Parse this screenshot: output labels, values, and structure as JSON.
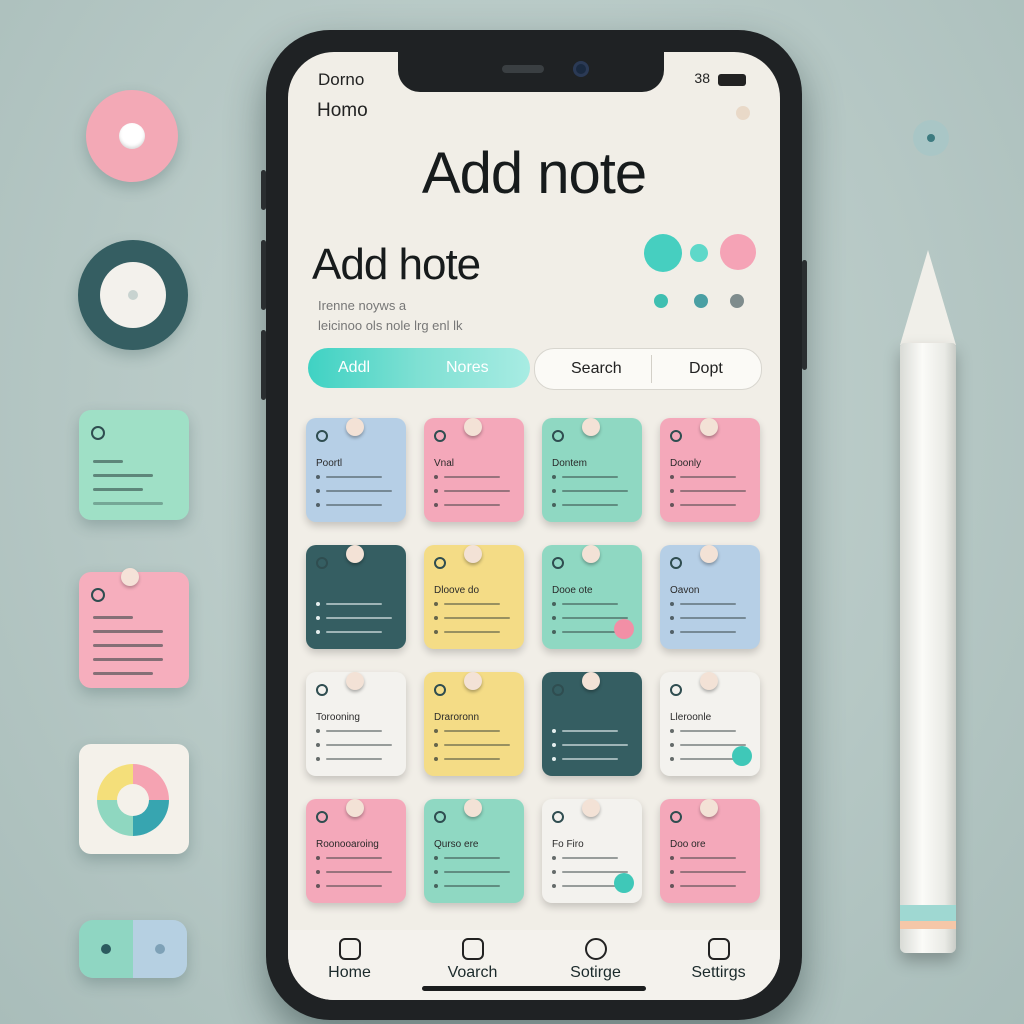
{
  "status_bar": {
    "left": "Dorno",
    "right": "38"
  },
  "header": {
    "nav_label": "Homo",
    "title_big": "Add note",
    "title_med": "Add hote",
    "subtitle_1": "Irenne noyws a",
    "subtitle_2": "leicinoo ols nole lrg enl lk"
  },
  "toolbar": {
    "add_label": "Addl",
    "notes_label": "Nores",
    "search_label": "Search",
    "sort_label": "Dopt"
  },
  "colors": {
    "accent_teal": "#3fd2c3",
    "pink": "#f4a8ba",
    "blue": "#b6cfe6",
    "mint": "#8fd8c2",
    "yellow": "#f4dc86",
    "dark": "#355e62",
    "white": "#f3f2ee"
  },
  "notes": [
    {
      "color": "blue",
      "title": "Poortl"
    },
    {
      "color": "pink",
      "title": "Vnal"
    },
    {
      "color": "mint",
      "title": "Dontem"
    },
    {
      "color": "pink",
      "title": "Doonly"
    },
    {
      "color": "dark",
      "title": ""
    },
    {
      "color": "yellow",
      "title": "Dloove do"
    },
    {
      "color": "mint",
      "title": "Dooe ote"
    },
    {
      "color": "blue",
      "title": "Oavon"
    },
    {
      "color": "white",
      "title": "Torooning"
    },
    {
      "color": "yellow",
      "title": "Draroronn"
    },
    {
      "color": "dark",
      "title": ""
    },
    {
      "color": "white",
      "title": "Lleroonle"
    },
    {
      "color": "pink",
      "title": "Roonooaroing"
    },
    {
      "color": "mint",
      "title": "Qurso ere"
    },
    {
      "color": "white",
      "title": "Fo Firo"
    },
    {
      "color": "pink",
      "title": "Doo ore"
    }
  ],
  "bottom_nav": [
    {
      "label": "Home",
      "icon": "home-icon"
    },
    {
      "label": "Voarch",
      "icon": "search-icon"
    },
    {
      "label": "Sotirge",
      "icon": "circle-icon"
    },
    {
      "label": "Settirgs",
      "icon": "settings-icon"
    }
  ]
}
